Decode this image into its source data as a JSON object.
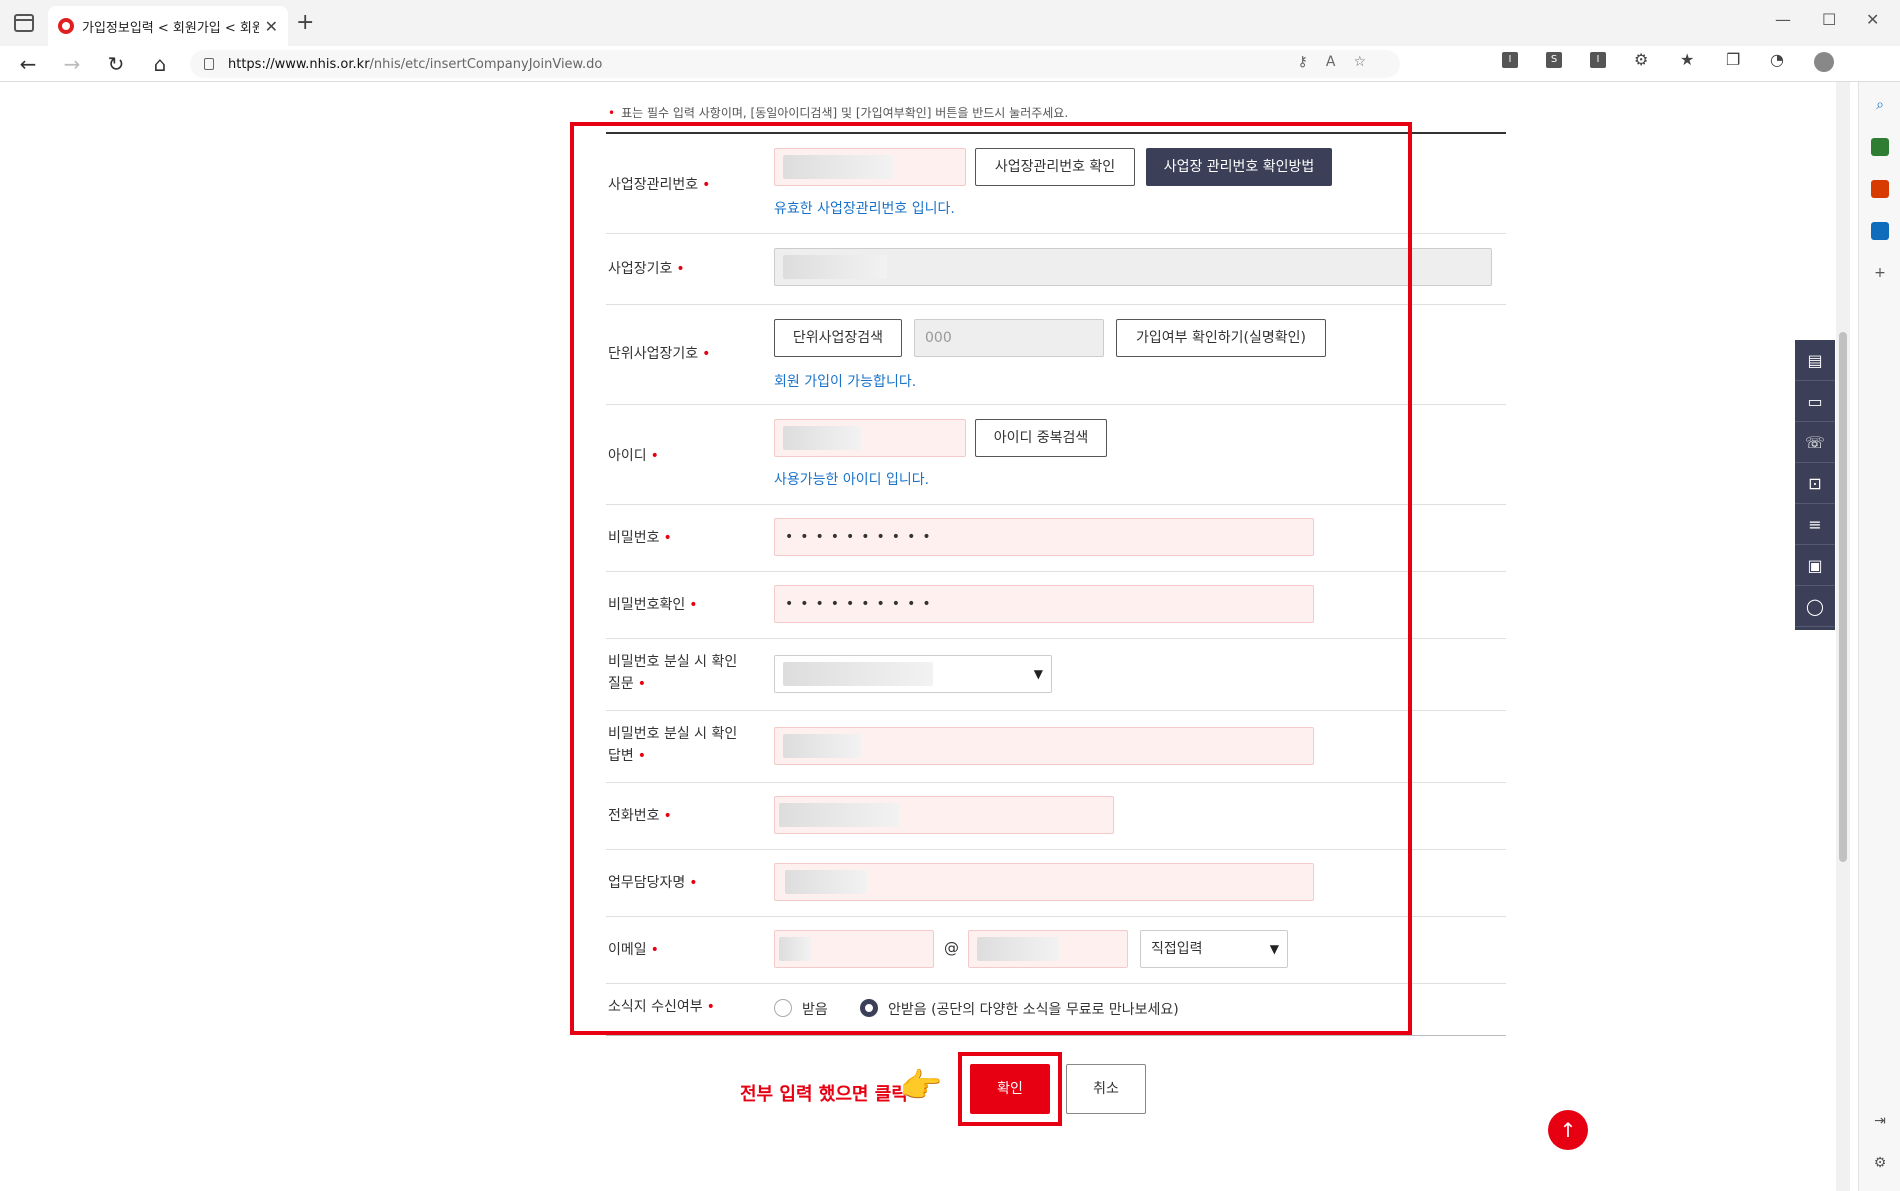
{
  "browser": {
    "tab_title": "가입정보입력 < 회원가입 < 회원",
    "tab_close": "✕",
    "new_tab": "+",
    "url_host": "https://www.nhis.or.kr",
    "url_path": "/nhis/etc/insertCompanyJoinView.do",
    "ext_labels": [
      "I",
      "S",
      "I"
    ]
  },
  "notice": "표는 필수 입력 사항이며, [동일아이디검색] 및 [가입여부확인] 버튼을 반드시 눌러주세요.",
  "form": {
    "biz_mgmt_no": {
      "label": "사업장관리번호",
      "check_button": "사업장관리번호 확인",
      "howto_button": "사업장 관리번호 확인방법",
      "message": "유효한 사업장관리번호 입니다."
    },
    "biz_symbol": {
      "label": "사업장기호"
    },
    "unit_biz_symbol": {
      "label": "단위사업장기호",
      "search_button": "단위사업장검색",
      "value": "000",
      "check_button": "가입여부 확인하기(실명확인)",
      "message": "회원 가입이 가능합니다."
    },
    "user_id": {
      "label": "아이디",
      "check_button": "아이디 중복검색",
      "message": "사용가능한 아이디 입니다."
    },
    "password": {
      "label": "비밀번호",
      "mask": "••••••••••"
    },
    "password_confirm": {
      "label": "비밀번호확인",
      "mask": "••••••••••"
    },
    "pw_question": {
      "label_line1": "비밀번호 분실 시 확인",
      "label_line2": "질문"
    },
    "pw_answer": {
      "label_line1": "비밀번호 분실 시 확인",
      "label_line2": "답변"
    },
    "phone": {
      "label": "전화번호"
    },
    "manager_name": {
      "label": "업무담당자명"
    },
    "email": {
      "label": "이메일",
      "at": "@",
      "domain_select": "직접입력"
    },
    "newsletter": {
      "label": "소식지 수신여부",
      "option_yes": "받음",
      "option_no": "안받음 (공단의 다양한 소식을 무료로 만나보세요)",
      "selected": "no"
    },
    "required_mark": "•"
  },
  "actions": {
    "confirm": "확인",
    "cancel": "취소",
    "annotation": "전부 입력 했으면 클릭"
  },
  "colors": {
    "accent_red": "#e60012",
    "dark_navy": "#3b3f57",
    "message_blue": "#1a73c9"
  }
}
